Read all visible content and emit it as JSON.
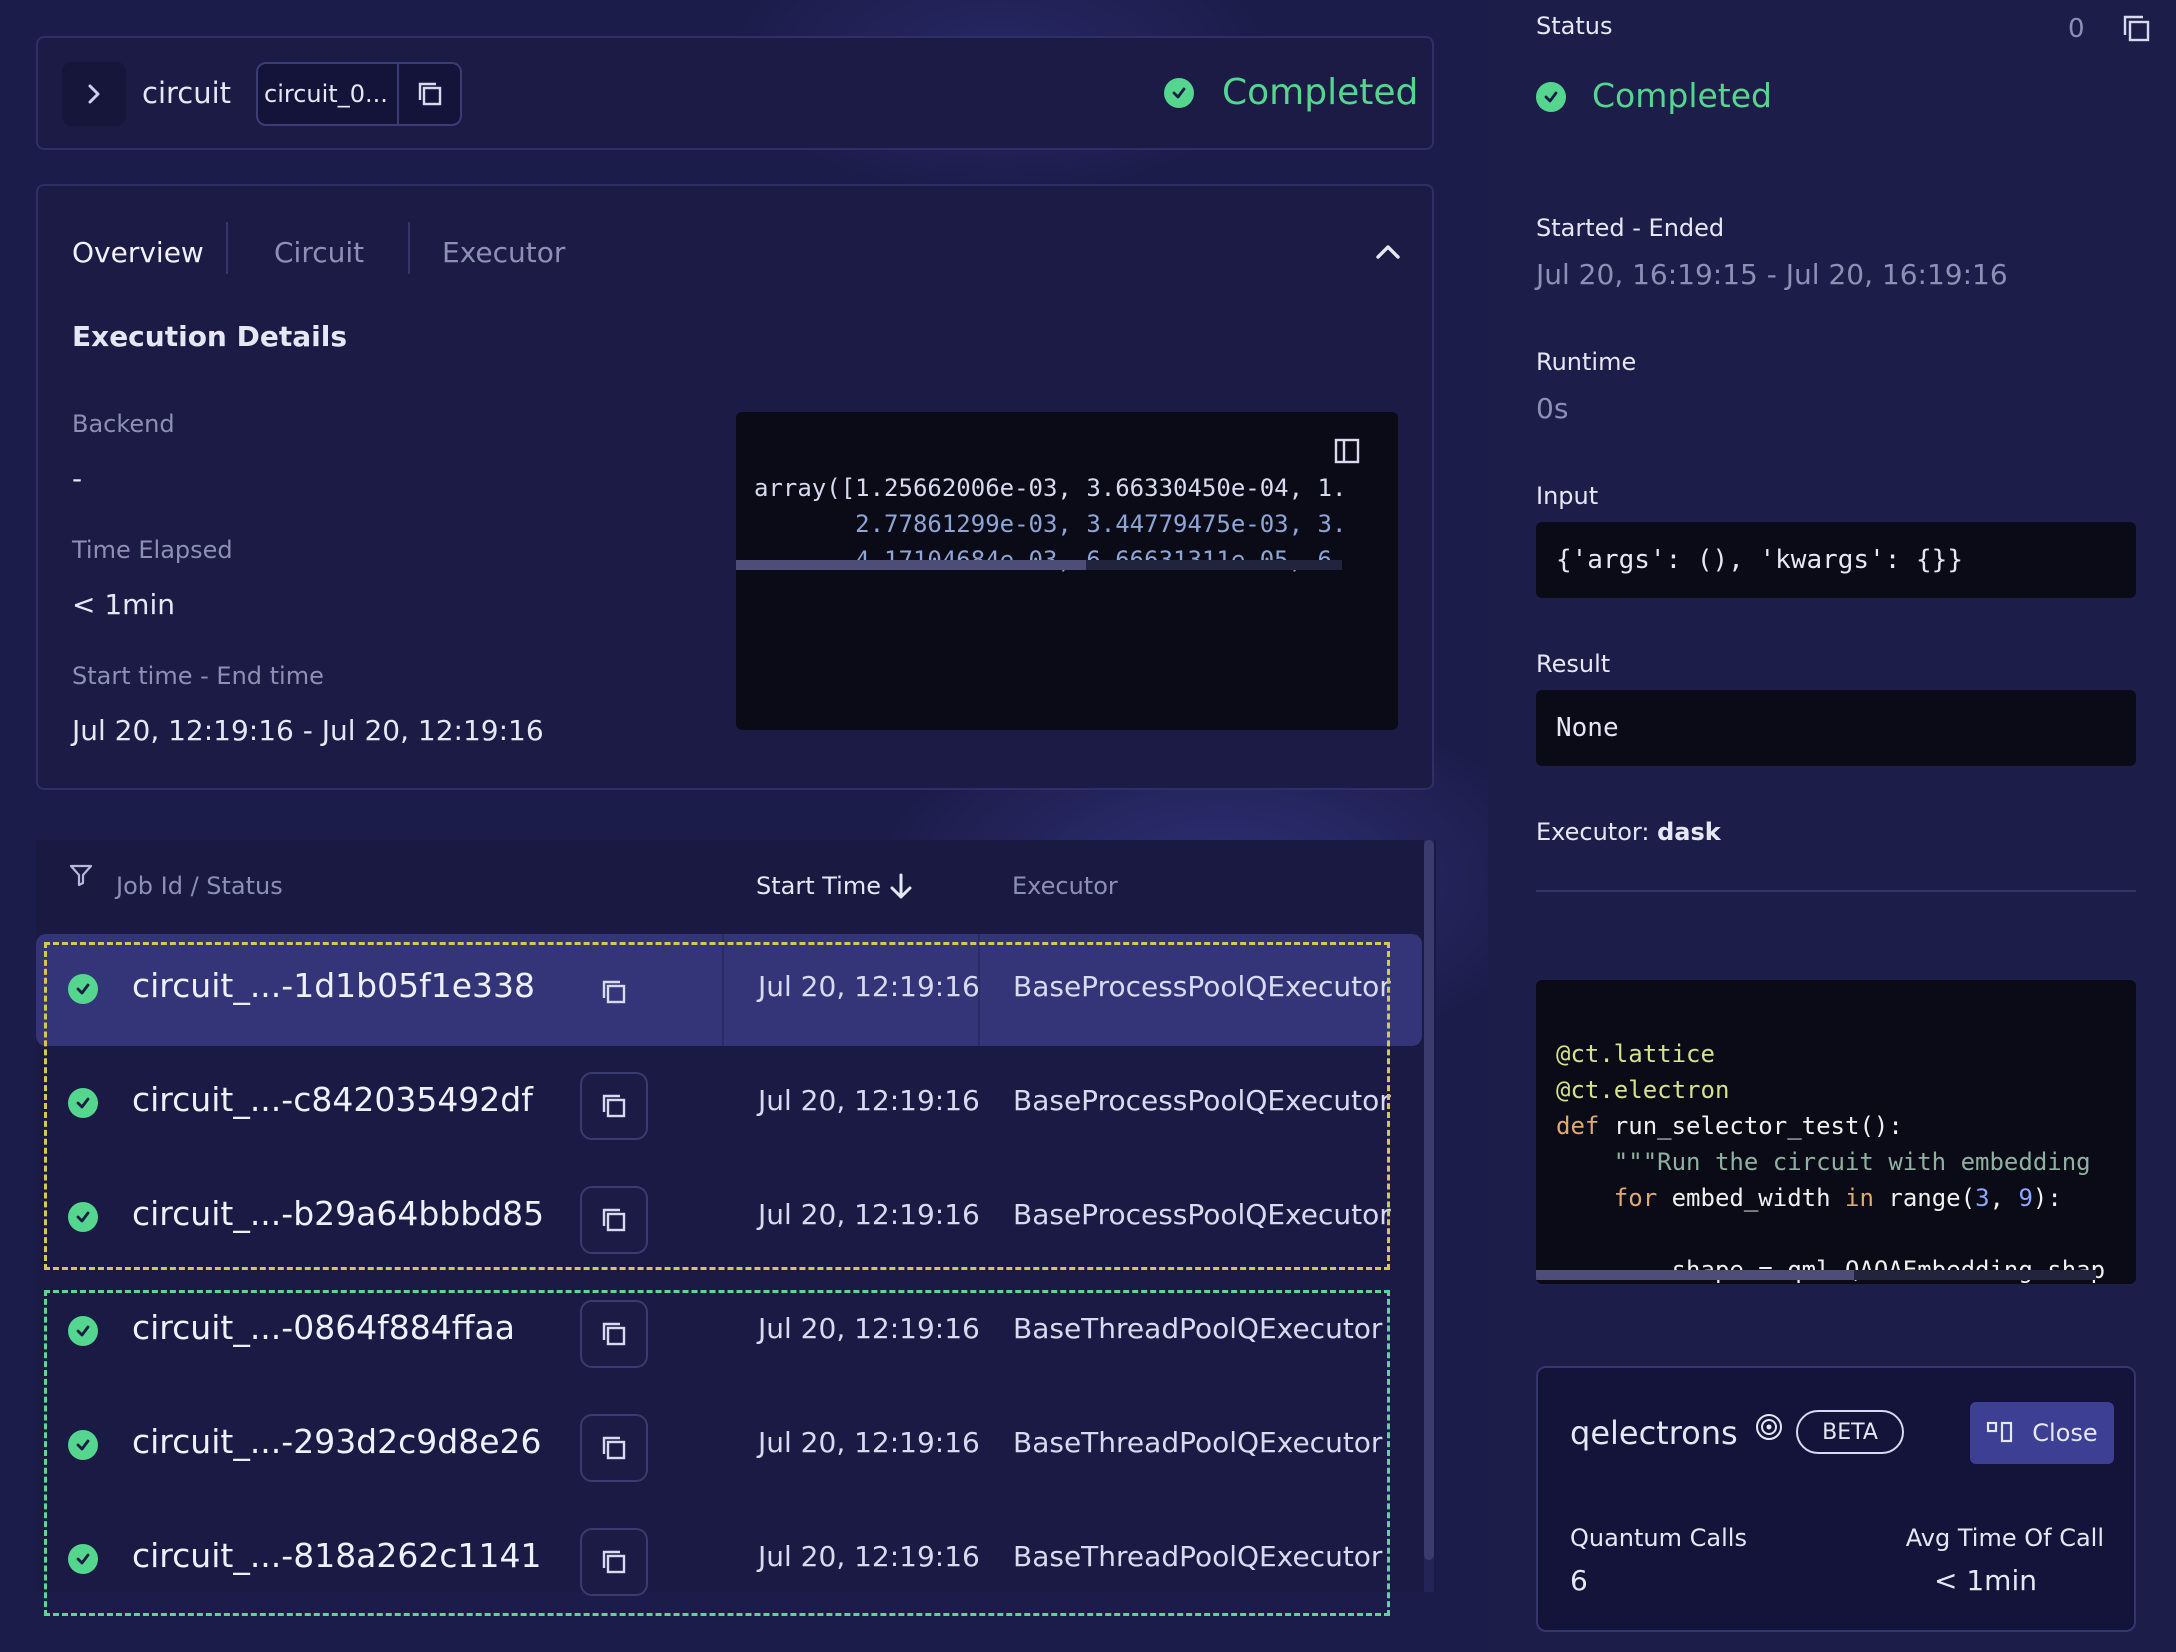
{
  "header": {
    "title": "circuit",
    "id_short": "circuit_0...",
    "status": "Completed"
  },
  "tabs": [
    {
      "label": "Overview"
    },
    {
      "label": "Circuit"
    },
    {
      "label": "Executor"
    }
  ],
  "overview": {
    "section_title": "Execution Details",
    "backend_label": "Backend",
    "backend_value": "-",
    "elapsed_label": "Time Elapsed",
    "elapsed_value": "< 1min",
    "range_label": "Start time - End time",
    "range_value": "Jul 20, 12:19:16 - Jul 20, 12:19:16",
    "code_lines": [
      "array([1.25662006e-03, 3.66330450e-04, 1.",
      "       2.77861299e-03, 3.44779475e-03, 3.",
      "       4.17104684e-03, 6.66631311e-05, 6."
    ]
  },
  "table": {
    "col_job": "Job Id / Status",
    "col_start": "Start Time",
    "col_executor": "Executor",
    "rows": [
      {
        "name": "circuit_...-1d1b05f1e338",
        "time": "Jul 20, 12:19:16",
        "executor": "BaseProcessPoolQExecutor"
      },
      {
        "name": "circuit_...-c842035492df",
        "time": "Jul 20, 12:19:16",
        "executor": "BaseProcessPoolQExecutor"
      },
      {
        "name": "circuit_...-b29a64bbbd85",
        "time": "Jul 20, 12:19:16",
        "executor": "BaseProcessPoolQExecutor"
      },
      {
        "name": "circuit_...-0864f884ffaa",
        "time": "Jul 20, 12:19:16",
        "executor": "BaseThreadPoolQExecutor"
      },
      {
        "name": "circuit_...-293d2c9d8e26",
        "time": "Jul 20, 12:19:16",
        "executor": "BaseThreadPoolQExecutor"
      },
      {
        "name": "circuit_...-818a262c1141",
        "time": "Jul 20, 12:19:16",
        "executor": "BaseThreadPoolQExecutor"
      }
    ]
  },
  "side": {
    "status_label": "Status",
    "count": "0",
    "status_value": "Completed",
    "started_label": "Started - Ended",
    "started_value": "Jul 20, 16:19:15 - Jul 20, 16:19:16",
    "runtime_label": "Runtime",
    "runtime_value": "0s",
    "input_label": "Input",
    "input_value": "{'args': (), 'kwargs': {}}",
    "result_label": "Result",
    "result_value": "None",
    "executor_label": "Executor:",
    "executor_value": "dask",
    "code": {
      "l1": "@ct.lattice",
      "l2": "@ct.electron",
      "l3_kw": "def",
      "l3_fn": "run_selector_test():",
      "l4": "\"\"\"Run the circuit with embedding",
      "l5_kw": "for",
      "l5_a": "embed_width",
      "l5_in": "in",
      "l5_b": "range(",
      "l5_n1": "3",
      "l5_c": ", ",
      "l5_n2": "9",
      "l5_d": "):",
      "l6": "shape = qml.QAOAEmbedding.shap"
    },
    "qelectrons": {
      "title": "qelectrons",
      "badge": "BETA",
      "close_label": "Close",
      "calls_label": "Quantum Calls",
      "calls_value": "6",
      "avg_label": "Avg Time Of Call",
      "avg_value": "< 1min"
    }
  },
  "colors": {
    "success": "#55d68e",
    "group_process": "#d8c552",
    "group_thread": "#5fd39a",
    "selected_row": "#333578"
  }
}
